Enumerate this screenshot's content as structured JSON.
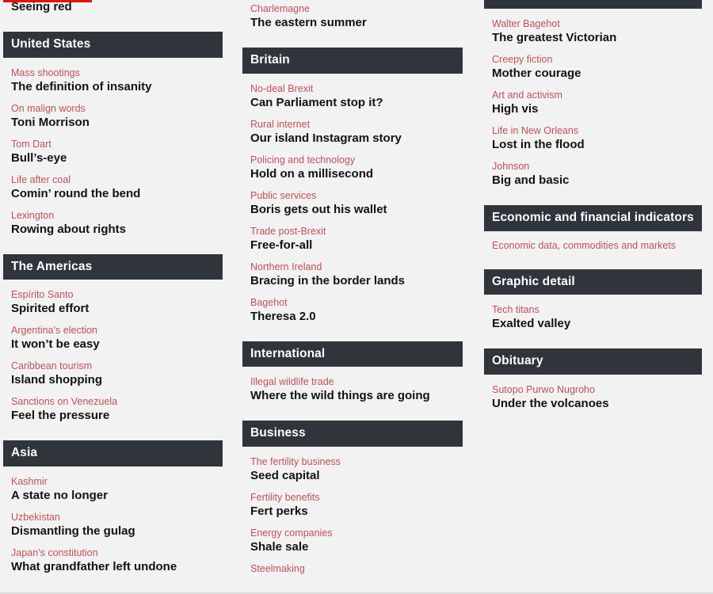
{
  "page": {
    "background_color": "#f2f2f2",
    "header_bar_color": "#2f353b",
    "kicker_color": "#c0505c",
    "headline_color": "#121212",
    "accent_red": "#e3120b"
  },
  "columns": [
    {
      "id": "column-1",
      "top_partial": {
        "headline": "Seeing red"
      },
      "sections": [
        {
          "title": "United States",
          "articles": [
            {
              "kicker": "Mass shootings",
              "headline": "The definition of insanity"
            },
            {
              "kicker": "On malign words",
              "headline": "Toni Morrison"
            },
            {
              "kicker": "Tom Dart",
              "headline": "Bull’s-eye"
            },
            {
              "kicker": "Life after coal",
              "headline": "Comin’ round the bend"
            },
            {
              "kicker": "Lexington",
              "headline": "Rowing about rights"
            }
          ]
        },
        {
          "title": "The Americas",
          "articles": [
            {
              "kicker": "Espírito Santo",
              "headline": "Spirited effort"
            },
            {
              "kicker": "Argentina’s election",
              "headline": "It won’t be easy"
            },
            {
              "kicker": "Caribbean tourism",
              "headline": "Island shopping"
            },
            {
              "kicker": "Sanctions on Venezuela",
              "headline": "Feel the pressure"
            }
          ]
        },
        {
          "title": "Asia",
          "articles": [
            {
              "kicker": "Kashmir",
              "headline": "A state no longer"
            },
            {
              "kicker": "Uzbekistan",
              "headline": "Dismantling the gulag"
            },
            {
              "kicker": "Japan’s constitution",
              "headline": "What grandfather left undone"
            }
          ]
        }
      ]
    },
    {
      "id": "column-2",
      "top_partial": {
        "kicker": "Charlemagne",
        "headline": "The eastern summer"
      },
      "sections": [
        {
          "title": "Britain",
          "articles": [
            {
              "kicker": "No-deal Brexit",
              "headline": "Can Parliament stop it?"
            },
            {
              "kicker": "Rural internet",
              "headline": "Our island Instagram story"
            },
            {
              "kicker": "Policing and technology",
              "headline": "Hold on a millisecond"
            },
            {
              "kicker": "Public services",
              "headline": "Boris gets out his wallet"
            },
            {
              "kicker": "Trade post-Brexit",
              "headline": "Free-for-all"
            },
            {
              "kicker": "Northern Ireland",
              "headline": "Bracing in the border lands"
            },
            {
              "kicker": "Bagehot",
              "headline": "Theresa 2.0"
            }
          ]
        },
        {
          "title": "International",
          "articles": [
            {
              "kicker": "Illegal wildlife trade",
              "headline": "Where the wild things are going"
            }
          ]
        },
        {
          "title": "Business",
          "articles": [
            {
              "kicker": "The fertility business",
              "headline": "Seed capital"
            },
            {
              "kicker": "Fertility benefits",
              "headline": "Fert perks"
            },
            {
              "kicker": "Energy companies",
              "headline": "Shale sale"
            },
            {
              "kicker": "Steelmaking",
              "headline": ""
            }
          ]
        }
      ]
    },
    {
      "id": "column-3",
      "top_partial": {
        "clipped_header": true
      },
      "sections": [
        {
          "title": "",
          "clipped": true,
          "articles": [
            {
              "kicker": "Walter Bagehot",
              "headline": "The greatest Victorian"
            },
            {
              "kicker": "Creepy fiction",
              "headline": "Mother courage"
            },
            {
              "kicker": "Art and activism",
              "headline": "High vis"
            },
            {
              "kicker": "Life in New Orleans",
              "headline": "Lost in the flood"
            },
            {
              "kicker": "Johnson",
              "headline": "Big and basic"
            }
          ]
        },
        {
          "title": "Economic and financial indicators",
          "indicators_line": "Economic data, commodities and markets",
          "articles": []
        },
        {
          "title": "Graphic detail",
          "articles": [
            {
              "kicker": "Tech titans",
              "headline": "Exalted valley"
            }
          ]
        },
        {
          "title": "Obituary",
          "articles": [
            {
              "kicker": "Sutopo Purwo Nugroho",
              "headline": "Under the volcanoes"
            }
          ]
        }
      ]
    }
  ]
}
